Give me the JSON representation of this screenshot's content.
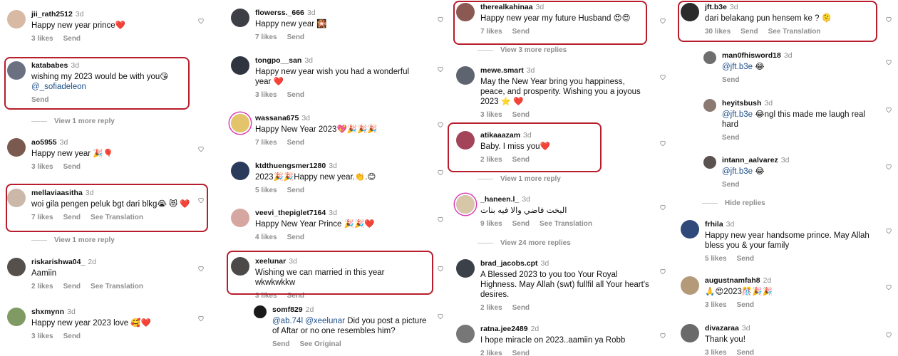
{
  "columns": [
    {
      "comments": [
        {
          "user": "jii_rath2512",
          "time": "3d",
          "text": "Happy new year prince❤️",
          "likes": "3 likes",
          "send": "Send",
          "avatar_color": "#d8b9a3"
        },
        {
          "user": "katababes",
          "time": "3d",
          "text": "wishing my 2023 would be with you😘",
          "mention": "@_sofiadeleon",
          "send": "Send",
          "avatar_color": "#6b7180"
        },
        {
          "user": "ao5955",
          "time": "3d",
          "text": "Happy new year 🎉🎈",
          "likes": "3 likes",
          "send": "Send",
          "avatar_color": "#7a5a4e"
        },
        {
          "user": "mellaviaasitha",
          "time": "3d",
          "text": "woi gila pengen peluk bgt dari blkg😭 😻 ❤️",
          "likes": "7 likes",
          "send": "Send",
          "see_translation": "See Translation",
          "avatar_color": "#cbb8a8"
        },
        {
          "user": "riskarishwa04_",
          "time": "2d",
          "text": "Aamiin",
          "likes": "2 likes",
          "send": "Send",
          "see_translation": "See Translation",
          "avatar_color": "#55504c"
        },
        {
          "user": "shxmynn",
          "time": "3d",
          "text": "Happy new year 2023 love 🥰❤️",
          "likes": "3 likes",
          "send": "Send",
          "avatar_color": "#7f9a63"
        }
      ],
      "view_more": [
        "View 1 more reply",
        "View 1 more reply"
      ]
    },
    {
      "comments": [
        {
          "user": "flowerss._666",
          "time": "3d",
          "text": "Happy new year 🎇",
          "likes": "7 likes",
          "send": "Send",
          "avatar_color": "#3e3e46"
        },
        {
          "user": "tongpo__san",
          "time": "3d",
          "text": "Happy new year wish you had a wonderful year ❤️",
          "likes": "3 likes",
          "send": "Send",
          "avatar_color": "#2f3440"
        },
        {
          "user": "wassana675",
          "time": "3d",
          "text": "Happy New Year  2023💖🎉🎉🎉",
          "likes": "7 likes",
          "send": "Send",
          "avatar_color": "#e4c46a"
        },
        {
          "user": "ktdthuengsmer1280",
          "time": "3d",
          "text": "2023🎉🎉Happy new year.👏.😊",
          "likes": "5 likes",
          "send": "Send",
          "avatar_color": "#2a3a5a"
        },
        {
          "user": "veevi_thepiglet7164",
          "time": "3d",
          "text": "Happy New Year Prince 🎉🎉❤️",
          "likes": "4 likes",
          "send": "Send",
          "avatar_color": "#d6a7a0"
        },
        {
          "user": "xeelunar",
          "time": "3d",
          "text": "Wishing we can married in this year wkwkwkkw",
          "likes": "3 likes",
          "send": "Send",
          "avatar_color": "#4c4a48"
        },
        {
          "user": "somf829",
          "time": "2d",
          "mention": "@ab.74l @xeelunar",
          "text": " Did you post a picture of Aftar or no one resembles him?",
          "send": "Send",
          "see_original": "See Original",
          "avatar_color": "#1a1a1a"
        }
      ]
    },
    {
      "comments": [
        {
          "user": "therealkahinaa",
          "time": "3d",
          "text": "Happy new year my future Husband 😍😍",
          "likes": "7 likes",
          "send": "Send",
          "avatar_color": "#8a5a52"
        },
        {
          "user": "mewe.smart",
          "time": "3d",
          "text": "May the New Year bring you happiness, peace, and prosperity. Wishing you a joyous 2023 ⭐ ❤️",
          "likes": "3 likes",
          "send": "Send",
          "avatar_color": "#5e6470"
        },
        {
          "user": "atikaaazam",
          "time": "3d",
          "text": "Baby. I miss you❤️",
          "likes": "2 likes",
          "send": "Send",
          "avatar_color": "#a3445a"
        },
        {
          "user": "_haneen.l_",
          "time": "3d",
          "text": "البخت فاضي والا فيه بنات",
          "likes": "9 likes",
          "send": "Send",
          "see_translation": "See Translation",
          "avatar_color": "#d7c7a8"
        },
        {
          "user": "brad_jacobs.cpt",
          "time": "3d",
          "text": "A Blessed 2023 to you too Your Royal Highness. May Allah (swt) fullfil all Your heart's desires.",
          "likes": "2 likes",
          "send": "Send",
          "avatar_color": "#3c4048"
        },
        {
          "user": "ratna.jee2489",
          "time": "2d",
          "text": "I hope miracle on 2023..aamiin ya Robb",
          "likes": "2 likes",
          "send": "Send",
          "avatar_color": "#777777"
        }
      ],
      "view_more": [
        "View 3 more replies",
        "View 1 more reply",
        "View 24 more replies"
      ]
    },
    {
      "comments": [
        {
          "user": "jft.b3e",
          "time": "3d",
          "text": "dari belakang pun hensem ke ? 🫠",
          "likes": "30 likes",
          "send": "Send",
          "see_translation": "See Translation",
          "avatar_color": "#2b2b2b"
        },
        {
          "user": "man0fhisword18",
          "time": "3d",
          "mention": "@jft.b3e",
          "text": " 😂",
          "send": "Send",
          "avatar_color": "#6e6e6e"
        },
        {
          "user": "heyitsbush",
          "time": "3d",
          "mention": "@jft.b3e",
          "text": " 😂ngl this made me laugh real hard",
          "send": "Send",
          "avatar_color": "#8a7a72"
        },
        {
          "user": "intann_aalvarez",
          "time": "3d",
          "mention": "@jft.b3e",
          "text": " 😂",
          "send": "Send",
          "avatar_color": "#5a5250"
        },
        {
          "user": "frhila",
          "time": "3d",
          "text": "Happy new year handsome prince. May Allah bless you & your family",
          "likes": "5 likes",
          "send": "Send",
          "avatar_color": "#2f4a7a"
        },
        {
          "user": "augustnamfah8",
          "time": "2d",
          "text": "🙏😍2023🎊🎉🎉",
          "likes": "3 likes",
          "send": "Send",
          "avatar_color": "#b59a7a"
        },
        {
          "user": "divazaraa",
          "time": "3d",
          "text": "Thank you!",
          "likes": "3 likes",
          "send": "Send",
          "avatar_color": "#6a6a6a"
        }
      ],
      "hide_replies": "Hide replies"
    }
  ]
}
